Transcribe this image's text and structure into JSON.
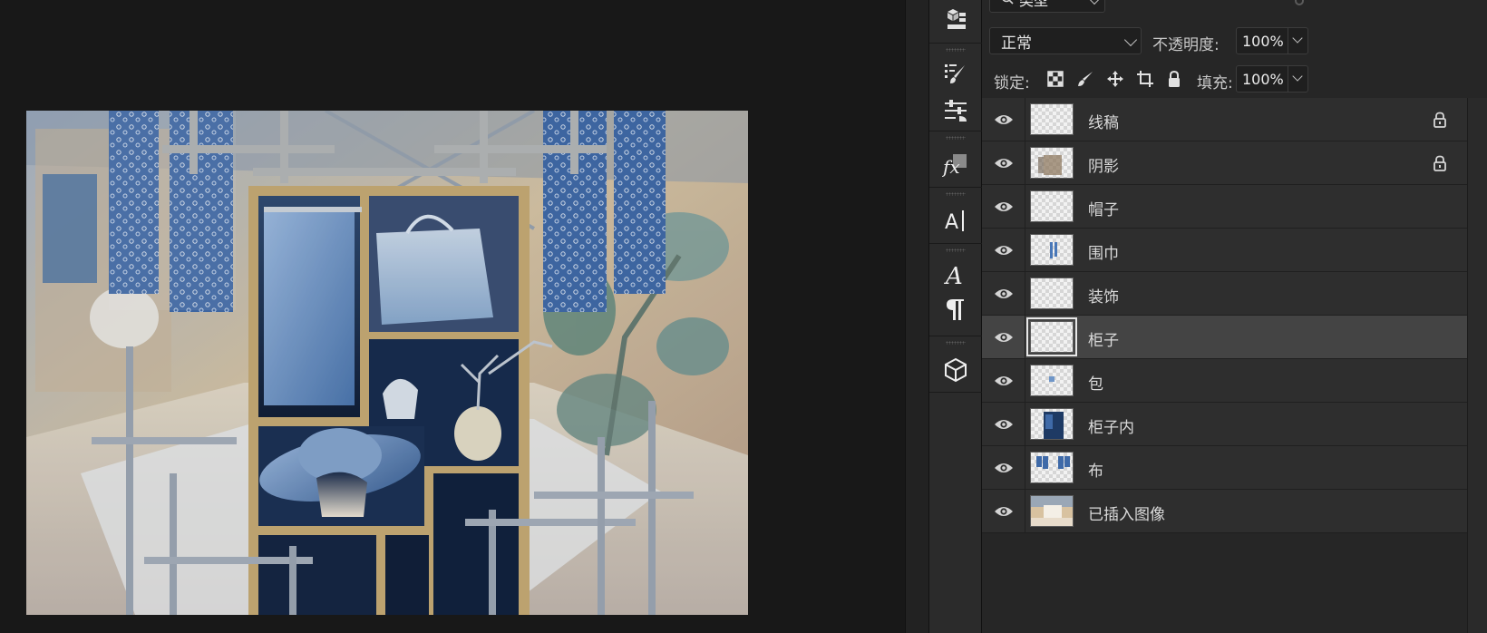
{
  "layers_panel": {
    "filter_kind": "类型",
    "blend_mode": "正常",
    "opacity_label": "不透明度:",
    "opacity_value": "100%",
    "lock_label": "锁定:",
    "fill_label": "填充:",
    "fill_value": "100%",
    "layers": [
      {
        "name": "线稿",
        "visible": true,
        "locked": true,
        "selected": false,
        "thumb": "transparent"
      },
      {
        "name": "阴影",
        "visible": true,
        "locked": true,
        "selected": false,
        "thumb": "shadow"
      },
      {
        "name": "帽子",
        "visible": true,
        "locked": false,
        "selected": false,
        "thumb": "transparent"
      },
      {
        "name": "围巾",
        "visible": true,
        "locked": false,
        "selected": false,
        "thumb": "scarf"
      },
      {
        "name": "装饰",
        "visible": true,
        "locked": false,
        "selected": false,
        "thumb": "transparent"
      },
      {
        "name": "柜子",
        "visible": true,
        "locked": false,
        "selected": true,
        "thumb": "transparent"
      },
      {
        "name": "包",
        "visible": true,
        "locked": false,
        "selected": false,
        "thumb": "bag"
      },
      {
        "name": "柜子内",
        "visible": true,
        "locked": false,
        "selected": false,
        "thumb": "cabinet-inner"
      },
      {
        "name": "布",
        "visible": true,
        "locked": false,
        "selected": false,
        "thumb": "cloth"
      },
      {
        "name": "已插入图像",
        "visible": true,
        "locked": false,
        "selected": false,
        "thumb": "photo"
      }
    ]
  },
  "tool_strip": {
    "items": [
      "libraries-icon",
      "brush-settings-icon",
      "adjustments-icon",
      "styles-icon",
      "character-icon",
      "glyphs-icon",
      "paragraph-icon",
      "3d-icon"
    ]
  },
  "colors": {
    "panel_bg": "#262626",
    "row_bg": "#2e2e2e",
    "row_selected": "#444444",
    "canvas_bg": "#181818"
  }
}
